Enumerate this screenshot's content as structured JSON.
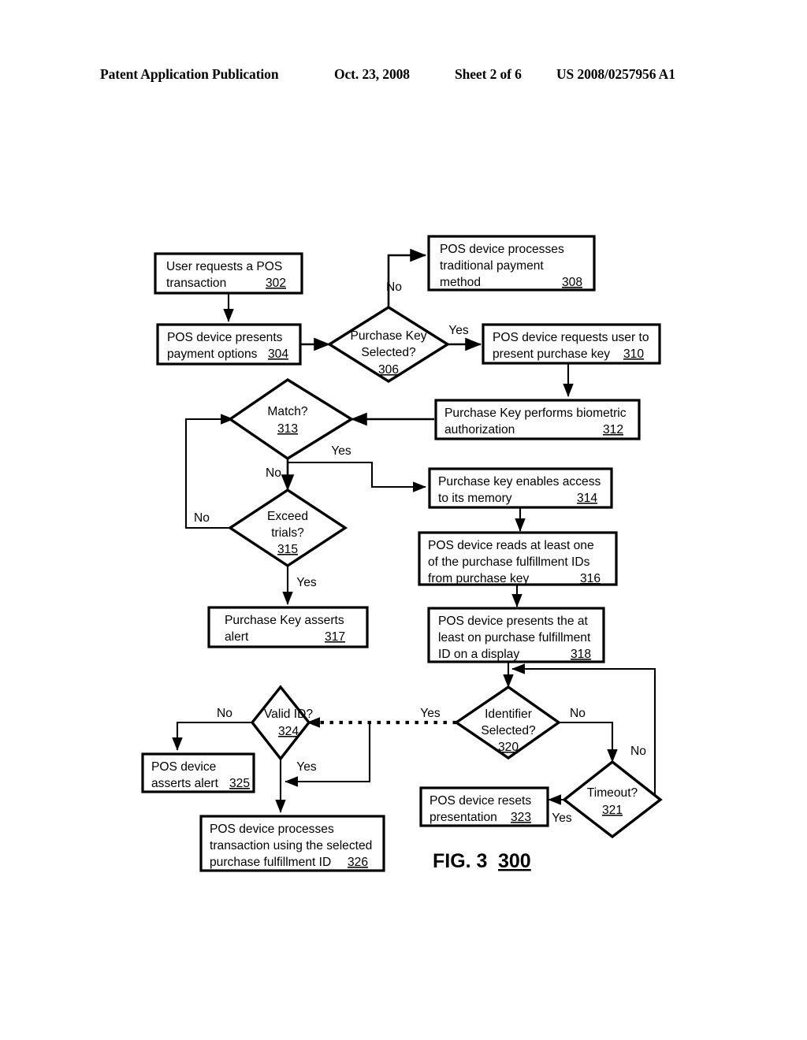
{
  "header": {
    "publication": "Patent Application Publication",
    "date": "Oct. 23, 2008",
    "sheet": "Sheet 2 of 6",
    "patent_number": "US 2008/0257956 A1"
  },
  "figure": {
    "caption": "FIG. 3",
    "figure_ref": "300"
  },
  "nodes": {
    "n302": {
      "ref": "302",
      "lines": [
        "User requests a POS",
        "transaction"
      ],
      "shape": "box"
    },
    "n304": {
      "ref": "304",
      "lines": [
        "POS device presents",
        "payment options"
      ],
      "shape": "box"
    },
    "n306": {
      "ref": "306",
      "lines": [
        "Purchase Key",
        "Selected?"
      ],
      "shape": "diamond"
    },
    "n308": {
      "ref": "308",
      "lines": [
        "POS device processes",
        "traditional payment",
        "method"
      ],
      "shape": "box"
    },
    "n310": {
      "ref": "310",
      "lines": [
        "POS device requests user to",
        "present purchase key"
      ],
      "shape": "box"
    },
    "n312": {
      "ref": "312",
      "lines": [
        "Purchase Key performs biometric",
        "authorization"
      ],
      "shape": "box"
    },
    "n313": {
      "ref": "313",
      "lines": [
        "Match?"
      ],
      "shape": "diamond"
    },
    "n314": {
      "ref": "314",
      "lines": [
        "Purchase key enables access",
        "to its memory"
      ],
      "shape": "box"
    },
    "n315": {
      "ref": "315",
      "lines": [
        "Exceed",
        "trials?"
      ],
      "shape": "diamond"
    },
    "n316": {
      "ref": "316",
      "lines": [
        "POS device reads at least one",
        "of the purchase fulfillment IDs",
        "from purchase key"
      ],
      "shape": "box"
    },
    "n317": {
      "ref": "317",
      "lines": [
        "Purchase Key asserts",
        "alert"
      ],
      "shape": "box"
    },
    "n318": {
      "ref": "318",
      "lines": [
        "POS device presents the at",
        "least on purchase fulfillment",
        "ID on a display"
      ],
      "shape": "box"
    },
    "n320": {
      "ref": "320",
      "lines": [
        "Identifier",
        "Selected?"
      ],
      "shape": "diamond"
    },
    "n321": {
      "ref": "321",
      "lines": [
        "Timeout?"
      ],
      "shape": "diamond"
    },
    "n323": {
      "ref": "323",
      "lines": [
        "POS device resets",
        "presentation"
      ],
      "shape": "box"
    },
    "n324": {
      "ref": "324",
      "lines": [
        "Valid ID?"
      ],
      "shape": "diamond"
    },
    "n325": {
      "ref": "325",
      "lines": [
        "POS device",
        "asserts alert"
      ],
      "shape": "box"
    },
    "n326": {
      "ref": "326",
      "lines": [
        "POS device processes",
        "transaction using the selected",
        "purchase fulfillment ID"
      ],
      "shape": "box"
    }
  },
  "edge_labels": {
    "e306_no": "No",
    "e306_yes": "Yes",
    "e313_yes": "Yes",
    "e313_no": "No",
    "e315_no": "No",
    "e315_yes": "Yes",
    "e320_yes": "Yes",
    "e320_no": "No",
    "e321_no": "No",
    "e321_yes": "Yes",
    "e324_no": "No",
    "e324_yes": "Yes"
  }
}
